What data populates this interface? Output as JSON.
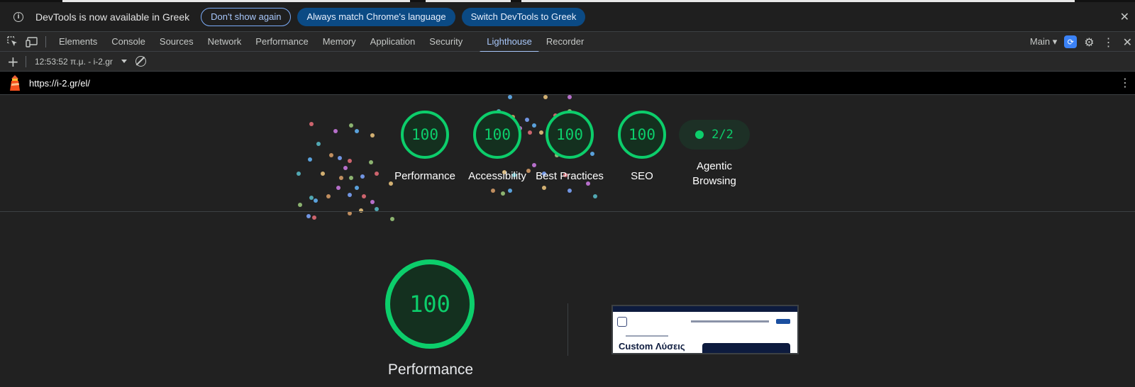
{
  "infobar": {
    "message": "DevTools is now available in Greek",
    "dont_show": "Don't show again",
    "always_match": "Always match Chrome's language",
    "switch": "Switch DevTools to Greek"
  },
  "tabs": [
    "Elements",
    "Console",
    "Sources",
    "Network",
    "Performance",
    "Memory",
    "Application",
    "Security",
    "Lighthouse",
    "Recorder"
  ],
  "active_tab": "Lighthouse",
  "toolbar_right": {
    "target": "Main"
  },
  "report": {
    "selector": "12:53:52 π.μ. - i-2.gr",
    "url": "https://i-2.gr/el/"
  },
  "scores": [
    {
      "label": "Performance",
      "value": "100"
    },
    {
      "label": "Accessibility",
      "value": "100"
    },
    {
      "label": "Best Practices",
      "value": "100"
    },
    {
      "label": "SEO",
      "value": "100"
    }
  ],
  "agentic": {
    "label": "Agentic Browsing",
    "value": "2/2"
  },
  "main_gauge": {
    "label": "Performance",
    "value": "100"
  },
  "thumbnail": {
    "heading": "Custom Λύσεις"
  },
  "colors": {
    "pass": "#0cce6b",
    "accent": "#a8c7fa"
  }
}
